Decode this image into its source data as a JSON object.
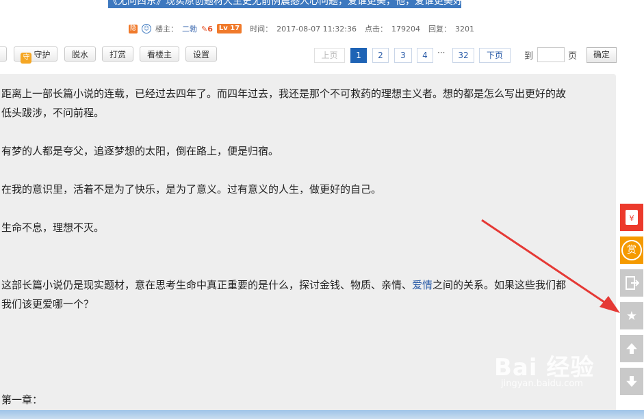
{
  "post": {
    "title_partial": "《无问西东》现实原创题材大生史无前例震撼人心问题，爱谁更美，他，爱谁更美好，",
    "meta": {
      "hide_icon": "eye-off-icon",
      "author_label": "楼主：",
      "author": "二勃",
      "badge_count": "6",
      "level": "Lv 17",
      "time_label": "时间：",
      "time": "2017-08-07 11:32:36",
      "views_label": "点击：",
      "views": "179204",
      "replies_label": "回复：",
      "replies": "3201"
    }
  },
  "toolbar": {
    "guard": "守护",
    "dehydrate": "脱水",
    "reward": "打赏",
    "only_op": "看楼主",
    "settings": "设置"
  },
  "pager": {
    "prev": "上页",
    "pages": [
      "1",
      "2",
      "3",
      "4"
    ],
    "ellipsis": "···",
    "last": "32",
    "next": "下页",
    "goto_label": "到",
    "page_label": "页",
    "confirm": "确定",
    "current": "1"
  },
  "content": {
    "p1_line1": "距离上一部长篇小说的连载，已经过去四年了。而四年过去，我还是那个不可救药的理想主义者。想的都是怎么写出更好的故",
    "p1_line2": "低头跋涉，不问前程。",
    "p2": "有梦的人都是夸父，追逐梦想的太阳，倒在路上，便是归宿。",
    "p3": "在我的意识里，活着不是为了快乐，是为了意义。过有意义的人生，做更好的自己。",
    "p4": "生命不息，理想不灭。",
    "p5_line1_a": "这部长篇小说仍是现实题材，意在思考生命中真正重要的是什么，探讨金钱、物质、亲情、",
    "p5_link": "爱情",
    "p5_line1_b": "之间的关系。如果这些我们都",
    "p5_line2": "我们该更爱哪一个？",
    "chapter": "第一章："
  },
  "sidebar": {
    "redpacket_icon": "red-packet-icon",
    "reward_label": "赏",
    "share_icon": "exit-share-icon",
    "favorite_icon": "star-icon",
    "top_icon": "arrow-up-icon",
    "bottom_icon": "arrow-down-icon"
  },
  "watermark": {
    "logo": "Bai 经验",
    "url": "jingyan.baidu.com"
  },
  "colors": {
    "accent_blue": "#1e63b5",
    "link_blue": "#2b5ca8",
    "annotation_red": "#e53935",
    "sidebar_red": "#ec3a2c",
    "sidebar_orange": "#f59a00"
  }
}
